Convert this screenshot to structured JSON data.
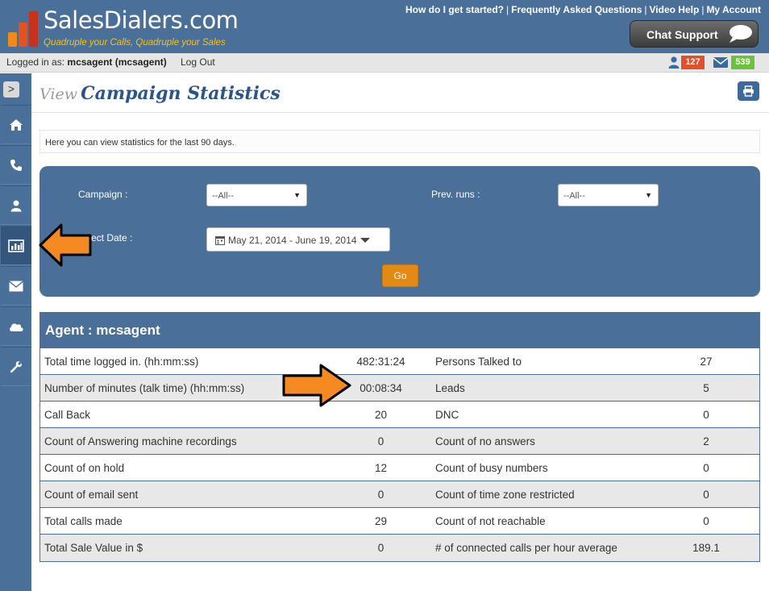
{
  "header": {
    "brand_name": "SalesDialers.com",
    "tagline": "Quadruple your Calls, Quadruple your Sales",
    "links": [
      "How do I get started?",
      "Frequently Asked Questions",
      "Video Help",
      "My Account"
    ],
    "chat_label": "Chat Support"
  },
  "login": {
    "prefix": "Logged in as:",
    "user": "mcsagent (mcsagent)",
    "logout": "Log Out",
    "users_count": "127",
    "mail_count": "539"
  },
  "sidebar": {
    "toggle": ">",
    "items": [
      "home-icon",
      "phone-icon",
      "user-icon",
      "chart-icon",
      "envelope-icon",
      "cloud-icon",
      "wrench-icon"
    ],
    "active_index": 3
  },
  "page": {
    "title_prefix": "View",
    "title": "Campaign Statistics",
    "info": "Here you can view statistics for the last 90 days."
  },
  "filters": {
    "campaign_label": "Campaign :",
    "campaign_value": "--All--",
    "prev_runs_label": "Prev. runs :",
    "prev_runs_value": "--All--",
    "date_label": "ect Date :",
    "date_value": "May 21, 2014 - June 19, 2014",
    "go": "Go"
  },
  "stats": {
    "heading": "Agent : mcsagent",
    "rows": [
      [
        "Total time logged in. (hh:mm:ss)",
        "482:31:24",
        "Persons Talked to",
        "27"
      ],
      [
        "Number of minutes (talk time) (hh:mm:ss)",
        "00:08:34",
        "Leads",
        "5"
      ],
      [
        "Call Back",
        "20",
        "DNC",
        "0"
      ],
      [
        "Count of Answering machine recordings",
        "0",
        "Count of no answers",
        "2"
      ],
      [
        "Count of on hold",
        "12",
        "Count of busy numbers",
        "0"
      ],
      [
        "Count of email sent",
        "0",
        "Count of time zone restricted",
        "0"
      ],
      [
        "Total calls made",
        "29",
        "Count of not reachable",
        "0"
      ],
      [
        "Total Sale Value in $",
        "0",
        "# of connected calls per hour average",
        "189.1"
      ]
    ]
  },
  "colors": {
    "header_blue": "#4a6f98",
    "accent_orange": "#e28a14",
    "badge_red": "#e0502c",
    "badge_green": "#6cc23e",
    "title_blue": "#2d5488"
  }
}
